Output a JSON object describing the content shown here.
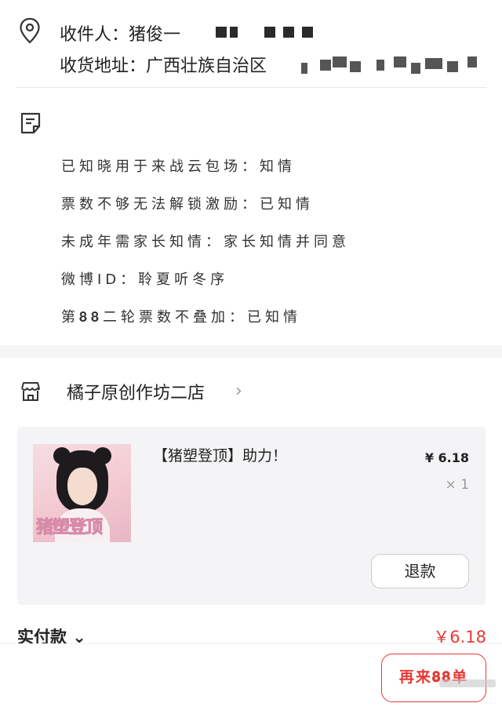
{
  "address": {
    "recipient_label": "收件人：猪俊一",
    "address_label": "收货地址：广西壮族自治区"
  },
  "notes": [
    "已知晓用于来战云包场：知情",
    "票数不够无法解锁激励：已知情",
    "未成年需家长知情：家长知情并同意",
    "微博ID：聆夏听冬序",
    "第𝟖𝟖二轮票数不叠加：已知情"
  ],
  "shop": {
    "name": "橘子原创作坊二店",
    "arrow": "›"
  },
  "product": {
    "title": "【猪塑登顶】助力！",
    "thumb_title": "猪塑登顶",
    "price": "¥ 6.18",
    "qty": "× 1",
    "refund_label": "退款"
  },
  "payment": {
    "label": "实付款 ⌄",
    "amount": "￥6.18"
  },
  "actions": {
    "buy_again_label": "再来𝟖𝟖单"
  },
  "colors": {
    "accent": "#e53935",
    "background": "#f5f5f5"
  }
}
